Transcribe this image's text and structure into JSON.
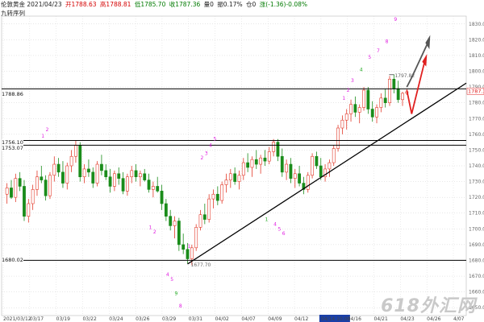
{
  "header": {
    "symbol_date": "伦敦黄金 2021/04/23",
    "open": "开1788.63",
    "high": "高1788.81",
    "low": "低1785.70",
    "close": "收1787.36",
    "volume": "量0",
    "amplitude": "振0.17%",
    "position": "仓0",
    "change": "涨(-1.36)-0.08%",
    "indicator": "九转序列"
  },
  "levels": {
    "resistance_top": "1788.86",
    "mid_a": "1756.10",
    "mid_b": "1753.07",
    "support": "1680.02",
    "low_mark": "1677.70",
    "high_mark": "1797.82",
    "current_price": "1787.36"
  },
  "x_axis": {
    "dates": [
      "2021/03/12",
      "03/17",
      "03/19",
      "03/22",
      "03/24",
      "03/26",
      "03/29",
      "03/31",
      "04/02",
      "04/07",
      "04/09",
      "04/12",
      "04/14 10:00",
      "04/16",
      "04/21",
      "04/23",
      "04/26",
      "4/07"
    ]
  },
  "y_axis": {
    "ticks": [
      "1830.00",
      "1820.00",
      "1810.00",
      "1800.00",
      "1790.00",
      "1780.00",
      "1770.00",
      "1760.00",
      "1750.00",
      "1740.00",
      "1730.00",
      "1720.00",
      "1710.00",
      "1700.00",
      "1690.00",
      "1680.00",
      "1670.00",
      "1660.00",
      "1650.00"
    ]
  },
  "watermark": "618外汇网",
  "colors": {
    "up": "#e23a2a",
    "down": "#1a8c1a",
    "td_magenta": "#e020e0",
    "td_green": "#22aa22",
    "trendline": "#000000",
    "arrow_up_red": "#e02020",
    "arrow_grey": "#555555"
  },
  "chart_data": {
    "type": "candlestick",
    "ylim": [
      1645,
      1835
    ],
    "candles": [
      [
        1722,
        1729,
        1716,
        1726
      ],
      [
        1726,
        1731,
        1719,
        1720
      ],
      [
        1720,
        1735,
        1717,
        1732
      ],
      [
        1732,
        1736,
        1724,
        1727
      ],
      [
        1727,
        1731,
        1705,
        1708
      ],
      [
        1708,
        1719,
        1704,
        1716
      ],
      [
        1716,
        1728,
        1712,
        1725
      ],
      [
        1725,
        1737,
        1721,
        1733
      ],
      [
        1733,
        1740,
        1729,
        1731
      ],
      [
        1731,
        1734,
        1718,
        1721
      ],
      [
        1721,
        1736,
        1719,
        1734
      ],
      [
        1734,
        1746,
        1730,
        1741
      ],
      [
        1741,
        1745,
        1733,
        1736
      ],
      [
        1736,
        1743,
        1726,
        1729
      ],
      [
        1729,
        1742,
        1725,
        1740
      ],
      [
        1740,
        1750,
        1736,
        1746
      ],
      [
        1746,
        1756,
        1742,
        1753
      ],
      [
        1753,
        1755,
        1730,
        1733
      ],
      [
        1733,
        1741,
        1729,
        1738
      ],
      [
        1738,
        1744,
        1733,
        1736
      ],
      [
        1736,
        1739,
        1726,
        1729
      ],
      [
        1729,
        1743,
        1727,
        1741
      ],
      [
        1741,
        1747,
        1734,
        1737
      ],
      [
        1737,
        1741,
        1731,
        1733
      ],
      [
        1733,
        1738,
        1723,
        1727
      ],
      [
        1727,
        1737,
        1724,
        1735
      ],
      [
        1735,
        1739,
        1728,
        1732
      ],
      [
        1732,
        1736,
        1722,
        1724
      ],
      [
        1724,
        1735,
        1721,
        1733
      ],
      [
        1733,
        1740,
        1729,
        1737
      ],
      [
        1737,
        1741,
        1730,
        1733
      ],
      [
        1733,
        1737,
        1727,
        1735
      ],
      [
        1735,
        1738,
        1730,
        1731
      ],
      [
        1731,
        1735,
        1723,
        1725
      ],
      [
        1725,
        1730,
        1720,
        1727
      ],
      [
        1727,
        1733,
        1723,
        1724
      ],
      [
        1724,
        1728,
        1712,
        1716
      ],
      [
        1716,
        1719,
        1705,
        1708
      ],
      [
        1708,
        1712,
        1699,
        1702
      ],
      [
        1702,
        1708,
        1694,
        1705
      ],
      [
        1705,
        1707,
        1686,
        1690
      ],
      [
        1690,
        1697,
        1684,
        1687
      ],
      [
        1687,
        1691,
        1678,
        1681
      ],
      [
        1681,
        1690,
        1677,
        1688
      ],
      [
        1688,
        1703,
        1686,
        1701
      ],
      [
        1701,
        1712,
        1699,
        1709
      ],
      [
        1709,
        1716,
        1703,
        1706
      ],
      [
        1706,
        1722,
        1704,
        1719
      ],
      [
        1719,
        1725,
        1713,
        1722
      ],
      [
        1722,
        1727,
        1715,
        1718
      ],
      [
        1718,
        1730,
        1716,
        1728
      ],
      [
        1728,
        1735,
        1723,
        1731
      ],
      [
        1731,
        1738,
        1726,
        1735
      ],
      [
        1735,
        1739,
        1728,
        1730
      ],
      [
        1730,
        1737,
        1725,
        1734
      ],
      [
        1734,
        1745,
        1731,
        1742
      ],
      [
        1742,
        1748,
        1736,
        1739
      ],
      [
        1739,
        1746,
        1733,
        1744
      ],
      [
        1744,
        1750,
        1738,
        1741
      ],
      [
        1741,
        1747,
        1735,
        1745
      ],
      [
        1745,
        1750,
        1740,
        1743
      ],
      [
        1743,
        1752,
        1741,
        1749
      ],
      [
        1749,
        1757,
        1746,
        1755
      ],
      [
        1755,
        1757,
        1743,
        1746
      ],
      [
        1746,
        1751,
        1733,
        1736
      ],
      [
        1736,
        1744,
        1731,
        1741
      ],
      [
        1741,
        1745,
        1729,
        1732
      ],
      [
        1732,
        1738,
        1726,
        1735
      ],
      [
        1735,
        1740,
        1727,
        1729
      ],
      [
        1729,
        1733,
        1722,
        1725
      ],
      [
        1725,
        1736,
        1723,
        1734
      ],
      [
        1734,
        1748,
        1732,
        1746
      ],
      [
        1746,
        1749,
        1738,
        1740
      ],
      [
        1740,
        1745,
        1731,
        1733
      ],
      [
        1733,
        1741,
        1730,
        1738
      ],
      [
        1738,
        1744,
        1733,
        1742
      ],
      [
        1742,
        1753,
        1740,
        1751
      ],
      [
        1751,
        1766,
        1749,
        1764
      ],
      [
        1764,
        1772,
        1760,
        1769
      ],
      [
        1769,
        1776,
        1763,
        1773
      ],
      [
        1773,
        1782,
        1768,
        1779
      ],
      [
        1779,
        1784,
        1771,
        1774
      ],
      [
        1774,
        1779,
        1767,
        1777
      ],
      [
        1777,
        1790,
        1775,
        1788
      ],
      [
        1788,
        1790,
        1773,
        1776
      ],
      [
        1776,
        1781,
        1768,
        1771
      ],
      [
        1771,
        1779,
        1767,
        1777
      ],
      [
        1777,
        1786,
        1774,
        1783
      ],
      [
        1783,
        1789,
        1777,
        1780
      ],
      [
        1780,
        1797,
        1778,
        1795
      ],
      [
        1795,
        1798,
        1786,
        1789
      ],
      [
        1789,
        1794,
        1780,
        1782
      ],
      [
        1782,
        1787,
        1778,
        1786
      ],
      [
        1786,
        1789,
        1785,
        1787
      ]
    ],
    "trendline": [
      [
        1677.7,
        "03/31"
      ],
      [
        1787,
        "04/23"
      ]
    ],
    "horizontal_levels": [
      1788.86,
      1756.1,
      1753.07,
      1680.02
    ]
  }
}
